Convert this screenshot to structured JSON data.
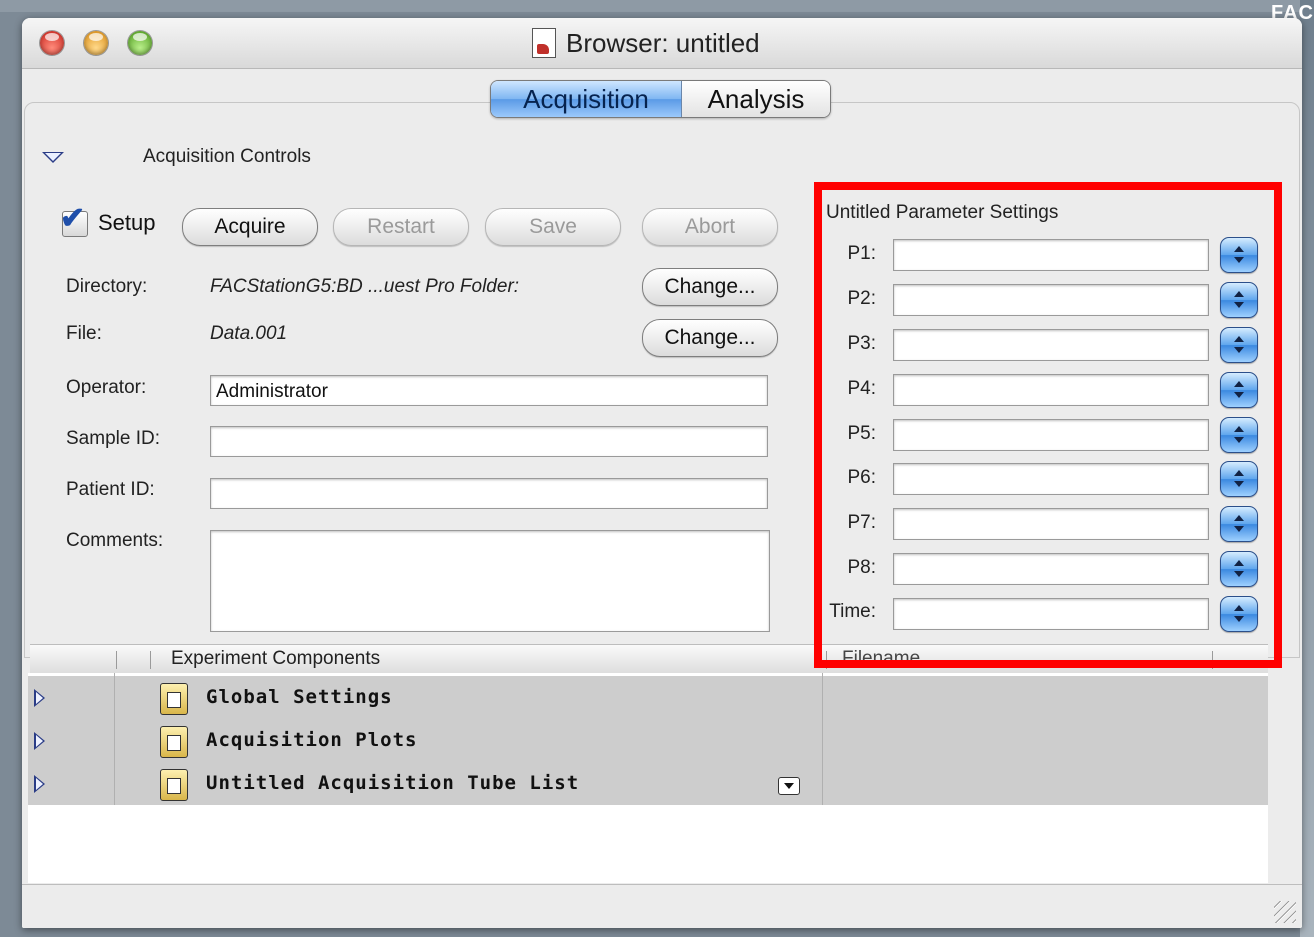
{
  "corner_text": "FAC",
  "window": {
    "title": "Browser: untitled"
  },
  "tabs": [
    {
      "label": "Acquisition",
      "active": true
    },
    {
      "label": "Analysis",
      "active": false
    }
  ],
  "section": {
    "label": "Acquisition Controls"
  },
  "setup": {
    "label": "Setup",
    "checked": true
  },
  "buttons": {
    "acquire": "Acquire",
    "restart": "Restart",
    "save": "Save",
    "abort": "Abort",
    "change": "Change..."
  },
  "fields": {
    "directory": {
      "label": "Directory:",
      "value": "FACStationG5:BD ...uest Pro Folder:"
    },
    "file": {
      "label": "File:",
      "value": "Data.001"
    },
    "operator": {
      "label": "Operator:",
      "value": "Administrator"
    },
    "sample_id": {
      "label": "Sample ID:",
      "value": ""
    },
    "patient_id": {
      "label": "Patient ID:",
      "value": ""
    },
    "comments": {
      "label": "Comments:",
      "value": ""
    }
  },
  "params": {
    "title": "Untitled Parameter Settings",
    "items": [
      {
        "label": "P1:"
      },
      {
        "label": "P2:"
      },
      {
        "label": "P3:"
      },
      {
        "label": "P4:"
      },
      {
        "label": "P5:"
      },
      {
        "label": "P6:"
      },
      {
        "label": "P7:"
      },
      {
        "label": "P8:"
      },
      {
        "label": "Time:"
      }
    ]
  },
  "table": {
    "header": "Experiment Components",
    "filename_header": "Filename",
    "rows": [
      {
        "label": "Global Settings"
      },
      {
        "label": "Acquisition Plots"
      },
      {
        "label": "Untitled Acquisition Tube List"
      }
    ]
  },
  "colors": {
    "highlight": "#ff0000",
    "accent": "#5a9ae6"
  }
}
